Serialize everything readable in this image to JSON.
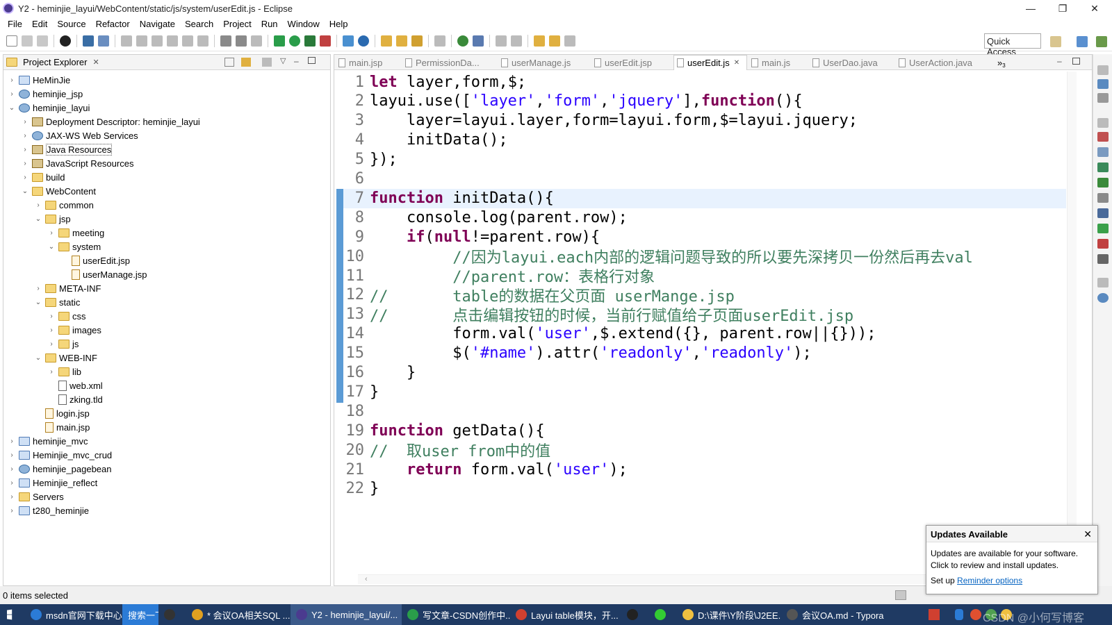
{
  "window": {
    "title": "Y2 - heminjie_layui/WebContent/static/js/system/userEdit.js - Eclipse",
    "min": "—",
    "max": "❐",
    "close": "✕"
  },
  "menu": [
    "File",
    "Edit",
    "Source",
    "Refactor",
    "Navigate",
    "Search",
    "Project",
    "Run",
    "Window",
    "Help"
  ],
  "toolbar": {
    "quick_access": "Quick Access"
  },
  "explorer": {
    "title": "Project Explorer",
    "close": "✕",
    "items": [
      {
        "label": "HeMinJie",
        "depth": 0,
        "twisty": "›",
        "icon": "project"
      },
      {
        "label": "heminjie_jsp",
        "depth": 0,
        "twisty": "›",
        "icon": "web"
      },
      {
        "label": "heminjie_layui",
        "depth": 0,
        "twisty": "⌄",
        "icon": "web"
      },
      {
        "label": "Deployment Descriptor: heminjie_layui",
        "depth": 1,
        "twisty": "›",
        "icon": "lib"
      },
      {
        "label": "JAX-WS Web Services",
        "depth": 1,
        "twisty": "›",
        "icon": "web"
      },
      {
        "label": "Java Resources",
        "depth": 1,
        "twisty": "›",
        "icon": "lib"
      },
      {
        "label": "JavaScript Resources",
        "depth": 1,
        "twisty": "›",
        "icon": "lib"
      },
      {
        "label": "build",
        "depth": 1,
        "twisty": "›",
        "icon": "folder"
      },
      {
        "label": "WebContent",
        "depth": 1,
        "twisty": "⌄",
        "icon": "folder"
      },
      {
        "label": "common",
        "depth": 2,
        "twisty": "›",
        "icon": "folder"
      },
      {
        "label": "jsp",
        "depth": 2,
        "twisty": "⌄",
        "icon": "folder"
      },
      {
        "label": "meeting",
        "depth": 3,
        "twisty": "›",
        "icon": "folder"
      },
      {
        "label": "system",
        "depth": 3,
        "twisty": "⌄",
        "icon": "folder"
      },
      {
        "label": "userEdit.jsp",
        "depth": 4,
        "twisty": "",
        "icon": "jsp"
      },
      {
        "label": "userManage.jsp",
        "depth": 4,
        "twisty": "",
        "icon": "jsp"
      },
      {
        "label": "META-INF",
        "depth": 2,
        "twisty": "›",
        "icon": "folder"
      },
      {
        "label": "static",
        "depth": 2,
        "twisty": "⌄",
        "icon": "folder"
      },
      {
        "label": "css",
        "depth": 3,
        "twisty": "›",
        "icon": "folder"
      },
      {
        "label": "images",
        "depth": 3,
        "twisty": "›",
        "icon": "folder"
      },
      {
        "label": "js",
        "depth": 3,
        "twisty": "›",
        "icon": "folder"
      },
      {
        "label": "WEB-INF",
        "depth": 2,
        "twisty": "⌄",
        "icon": "folder"
      },
      {
        "label": "lib",
        "depth": 3,
        "twisty": "›",
        "icon": "folder"
      },
      {
        "label": "web.xml",
        "depth": 3,
        "twisty": "",
        "icon": "xml"
      },
      {
        "label": "zking.tld",
        "depth": 3,
        "twisty": "",
        "icon": "xml"
      },
      {
        "label": "login.jsp",
        "depth": 2,
        "twisty": "",
        "icon": "jsp"
      },
      {
        "label": "main.jsp",
        "depth": 2,
        "twisty": "",
        "icon": "jsp"
      },
      {
        "label": "heminjie_mvc",
        "depth": 0,
        "twisty": "›",
        "icon": "project"
      },
      {
        "label": "Heminjie_mvc_crud",
        "depth": 0,
        "twisty": "›",
        "icon": "project"
      },
      {
        "label": "heminjie_pagebean",
        "depth": 0,
        "twisty": "›",
        "icon": "web"
      },
      {
        "label": "Heminjie_reflect",
        "depth": 0,
        "twisty": "›",
        "icon": "project"
      },
      {
        "label": "Servers",
        "depth": 0,
        "twisty": "›",
        "icon": "folder"
      },
      {
        "label": "t280_heminjie",
        "depth": 0,
        "twisty": "›",
        "icon": "project"
      }
    ]
  },
  "editor": {
    "tabs": [
      {
        "label": "main.jsp",
        "active": false
      },
      {
        "label": "PermissionDa...",
        "active": false
      },
      {
        "label": "userManage.js",
        "active": false
      },
      {
        "label": "userEdit.jsp",
        "active": false
      },
      {
        "label": "userEdit.js",
        "active": true
      },
      {
        "label": "main.js",
        "active": false
      },
      {
        "label": "UserDao.java",
        "active": false
      },
      {
        "label": "UserAction.java",
        "active": false
      }
    ],
    "tab_close": "✕",
    "overflow": "»",
    "overflow_count": "3",
    "lines": [
      [
        [
          "kw",
          "let"
        ],
        [
          "p",
          " layer,form,$;"
        ]
      ],
      [
        [
          "p",
          "layui.use(["
        ],
        [
          "str",
          "'layer'"
        ],
        [
          "p",
          ","
        ],
        [
          "str",
          "'form'"
        ],
        [
          "p",
          ","
        ],
        [
          "str",
          "'jquery'"
        ],
        [
          "p",
          "],"
        ],
        [
          "kw",
          "function"
        ],
        [
          "p",
          "(){"
        ]
      ],
      [
        [
          "p",
          "    layer=layui.layer,form=layui.form,$=layui.jquery;"
        ]
      ],
      [
        [
          "p",
          "    initData();"
        ]
      ],
      [
        [
          "p",
          "});"
        ]
      ],
      [
        [
          "p",
          ""
        ]
      ],
      [
        [
          "kw",
          "function"
        ],
        [
          "p",
          " initData(){"
        ]
      ],
      [
        [
          "p",
          "    console.log(parent.row);"
        ]
      ],
      [
        [
          "p",
          "    "
        ],
        [
          "kw",
          "if"
        ],
        [
          "p",
          "("
        ],
        [
          "kw",
          "null"
        ],
        [
          "p",
          "!=parent.row){"
        ]
      ],
      [
        [
          "p",
          "         "
        ],
        [
          "cm",
          "//因为layui.each内部的逻辑问题导致的所以要先深拷贝一份然后再去val"
        ]
      ],
      [
        [
          "p",
          "         "
        ],
        [
          "cm",
          "//parent.row：表格行对象"
        ]
      ],
      [
        [
          "cm",
          "//       table的数据在父页面 userMange.jsp"
        ]
      ],
      [
        [
          "cm",
          "//       点击编辑按钮的时候，当前行赋值给子页面userEdit.jsp"
        ]
      ],
      [
        [
          "p",
          "         form.val("
        ],
        [
          "str",
          "'user'"
        ],
        [
          "p",
          ",$.extend({}, parent.row||{}));"
        ]
      ],
      [
        [
          "p",
          "         $("
        ],
        [
          "str",
          "'#name'"
        ],
        [
          "p",
          ").attr("
        ],
        [
          "str",
          "'readonly'"
        ],
        [
          "p",
          ","
        ],
        [
          "str",
          "'readonly'"
        ],
        [
          "p",
          ");"
        ]
      ],
      [
        [
          "p",
          "    }"
        ]
      ],
      [
        [
          "p",
          "}"
        ]
      ],
      [
        [
          "p",
          ""
        ]
      ],
      [
        [
          "kw",
          "function"
        ],
        [
          "p",
          " getData(){"
        ]
      ],
      [
        [
          "cm",
          "//  取user from中的值"
        ]
      ],
      [
        [
          "p",
          "    "
        ],
        [
          "kw",
          "return"
        ],
        [
          "p",
          " form.val("
        ],
        [
          "str",
          "'user'"
        ],
        [
          "p",
          ");"
        ]
      ],
      [
        [
          "p",
          "}"
        ]
      ]
    ]
  },
  "status": {
    "text": "0 items selected"
  },
  "popup": {
    "title": "Updates Available",
    "close": "✕",
    "body": "Updates are available for your software. Click to review and install updates.",
    "link_prefix": "Set up ",
    "link": "Reminder options"
  },
  "taskbar": {
    "items": [
      {
        "label": "msdn官网下载中心",
        "color": "#2b7bd6"
      },
      {
        "label": "搜索一下",
        "color": "#2b7bd6"
      },
      {
        "label": "",
        "color": "#333333"
      },
      {
        "label": "* 会议OA相关SQL ...",
        "color": "#e0a020"
      },
      {
        "label": "Y2 - heminjie_layui/...",
        "color": "#4b3b8f"
      },
      {
        "label": "写文章-CSDN创作中...",
        "color": "#2a9d4a"
      },
      {
        "label": "Layui table模块，开...",
        "color": "#d04030"
      },
      {
        "label": "",
        "color": "#222222"
      },
      {
        "label": "",
        "color": "#33cc33"
      },
      {
        "label": "D:\\课件\\Y阶段\\J2EE...",
        "color": "#f0c040"
      },
      {
        "label": "会议OA.md - Typora",
        "color": "#555555"
      }
    ],
    "watermark": "CSDN @小何写博客"
  },
  "colors": {
    "keyword": "#7f0055",
    "string": "#2a00ff",
    "comment": "#3f7f5f",
    "taskbar": "#1f3a63"
  }
}
